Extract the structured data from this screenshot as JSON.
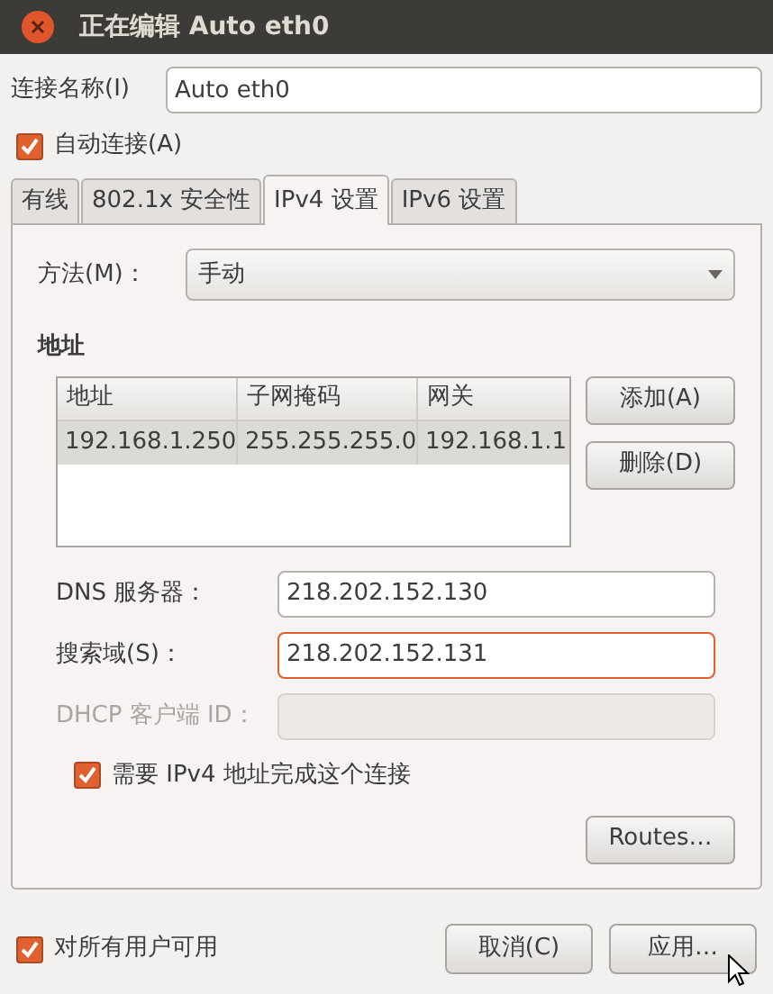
{
  "window": {
    "title": "正在编辑 Auto eth0"
  },
  "connection_name": {
    "label": "连接名称(I)",
    "value": "Auto eth0"
  },
  "auto_connect": {
    "label": "自动连接(A)",
    "checked": true
  },
  "tabs": [
    {
      "label": "有线",
      "selected": false
    },
    {
      "label": "802.1x 安全性",
      "selected": false
    },
    {
      "label": "IPv4 设置",
      "selected": true
    },
    {
      "label": "IPv6 设置",
      "selected": false
    }
  ],
  "method": {
    "label": "方法(M)：",
    "value": "手动"
  },
  "addresses": {
    "heading": "地址",
    "columns": [
      "地址",
      "子网掩码",
      "网关"
    ],
    "rows": [
      {
        "cells": [
          "192.168.1.250",
          "255.255.255.0",
          "192.168.1.1"
        ],
        "selected": true
      }
    ],
    "buttons": [
      "添加(A)",
      "删除(D)"
    ]
  },
  "fields": [
    {
      "label": "DNS 服务器：",
      "value": "218.202.152.130",
      "focused": false,
      "disabled": false
    },
    {
      "label": "搜索域(S)：",
      "value": "218.202.152.131",
      "focused": true,
      "disabled": false
    },
    {
      "label": "DHCP 客户端 ID：",
      "focused": false,
      "disabled": true
    }
  ],
  "require_ipv4": {
    "label": "需要 IPv4 地址完成这个连接",
    "checked": true
  },
  "routes_button": "Routes…",
  "all_users": {
    "label": "对所有用户可用",
    "checked": true
  },
  "buttons": [
    "取消(C)",
    "应用…"
  ]
}
